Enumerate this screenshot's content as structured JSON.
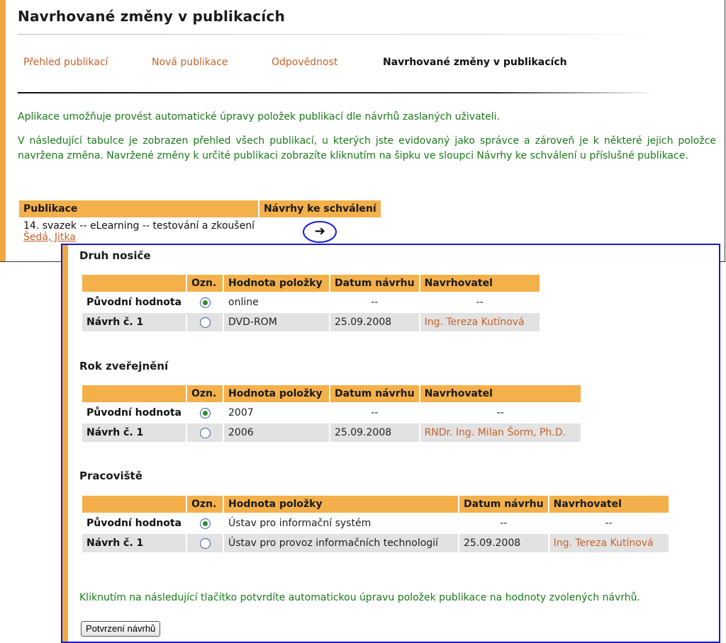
{
  "page": {
    "title": "Navrhované změny v publikacích",
    "nav": [
      {
        "label": "Přehled publikací"
      },
      {
        "label": "Nová publikace"
      },
      {
        "label": "Odpovědnost"
      },
      {
        "label": "Navrhované změny v publikacích",
        "active": true
      }
    ],
    "intro1": "Aplikace umožňuje provést automatické úpravy položek publikací dle návrhů zaslaných uživateli.",
    "intro2": "V následující tabulce je zobrazen přehled všech publikací, u kterých jste evidovaný jako správce a zároveň je k některé jejich položce navržena změna. Navržené změny k určité publikaci zobrazíte kliknutím na šipku ve sloupci Návrhy ke schválení u příslušné publikace.",
    "table": {
      "col_publikace": "Publikace",
      "col_navrhy": "Návrhy ke schválení",
      "row": {
        "name": "14. svazek -- eLearning -- testování a zkoušení",
        "author": "Šedá, Jitka",
        "arrow_icon": "right-arrow-icon"
      }
    }
  },
  "panel": {
    "headers": {
      "ozn": "Ozn.",
      "hodnota": "Hodnota položky",
      "datum": "Datum návrhu",
      "navrhovatel": "Navrhovatel"
    },
    "sections": [
      {
        "title": "Druh nosiče",
        "rows": [
          {
            "label": "Původní hodnota",
            "checked": true,
            "value": "online",
            "date": "--",
            "proposer": "--"
          },
          {
            "label": "Návrh č. 1",
            "checked": false,
            "value": "DVD-ROM",
            "date": "25.09.2008",
            "proposer": "Ing. Tereza Kutínová"
          }
        ]
      },
      {
        "title": "Rok zveřejnění",
        "rows": [
          {
            "label": "Původní hodnota",
            "checked": true,
            "value": "2007",
            "date": "--",
            "proposer": "--"
          },
          {
            "label": "Návrh č. 1",
            "checked": false,
            "value": "2006",
            "date": "25.09.2008",
            "proposer": "RNDr. Ing. Milan Šorm, Ph.D."
          }
        ]
      },
      {
        "title": "Pracoviště",
        "rows": [
          {
            "label": "Původní hodnota",
            "checked": true,
            "value": "Ústav pro informační systém",
            "date": "--",
            "proposer": "--"
          },
          {
            "label": "Návrh č. 1",
            "checked": false,
            "value": "Ústav pro provoz informačních technologií",
            "date": "25.09.2008",
            "proposer": "Ing. Tereza Kutínová"
          }
        ]
      }
    ],
    "confirm_text": "Kliknutím na následující tlačítko potvrdíte automatickou úpravu položek publikace na hodnoty zvolených návrhů.",
    "confirm_button": "Potvrzení návrhů"
  },
  "colors": {
    "accent_orange": "#f4b04a",
    "link_orange": "#c5622a",
    "text_green": "#1a7a1a",
    "panel_border_blue": "#1a1ad0"
  }
}
